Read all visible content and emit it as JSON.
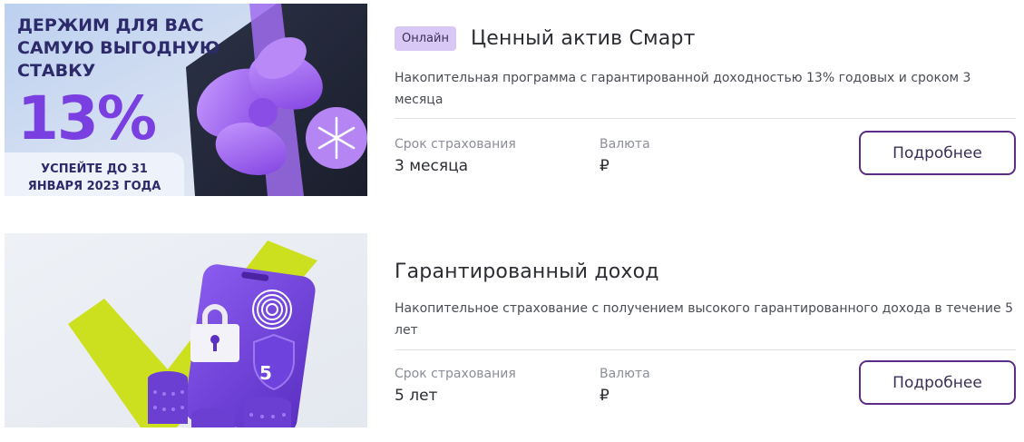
{
  "products": [
    {
      "badge": "Онлайн",
      "title": "Ценный актив Смарт",
      "description": "Накопительная программа с гарантированной доходностью 13% годовых и сроком 3 месяца",
      "term_label": "Срок страхования",
      "term_value": "3 месяца",
      "currency_label": "Валюта",
      "currency_value": "₽",
      "button_label": "Подробнее",
      "banner": {
        "headline_line1": "ДЕРЖИМ ДЛЯ ВАС",
        "headline_line2": "САМУЮ ВЫГОДНУЮ",
        "headline_line3": "СТАВКУ",
        "rate": "13%",
        "deadline_line1": "УСПЕЙТЕ ДО 31",
        "deadline_line2": "ЯНВАРЯ 2023 ГОДА"
      }
    },
    {
      "title": "Гарантированный доход",
      "description": "Накопительное страхование с получением высокого гарантированного дохода в течение 5 лет",
      "term_label": "Срок страхования",
      "term_value": "5 лет",
      "currency_label": "Валюта",
      "currency_value": "₽",
      "button_label": "Подробнее",
      "banner": {
        "shield_number": "5"
      }
    }
  ],
  "colors": {
    "accent": "#5b2d86",
    "badge_bg": "#d8c8f6",
    "banner_purple": "#6b3fd1",
    "banner_lime": "#cde01f"
  }
}
